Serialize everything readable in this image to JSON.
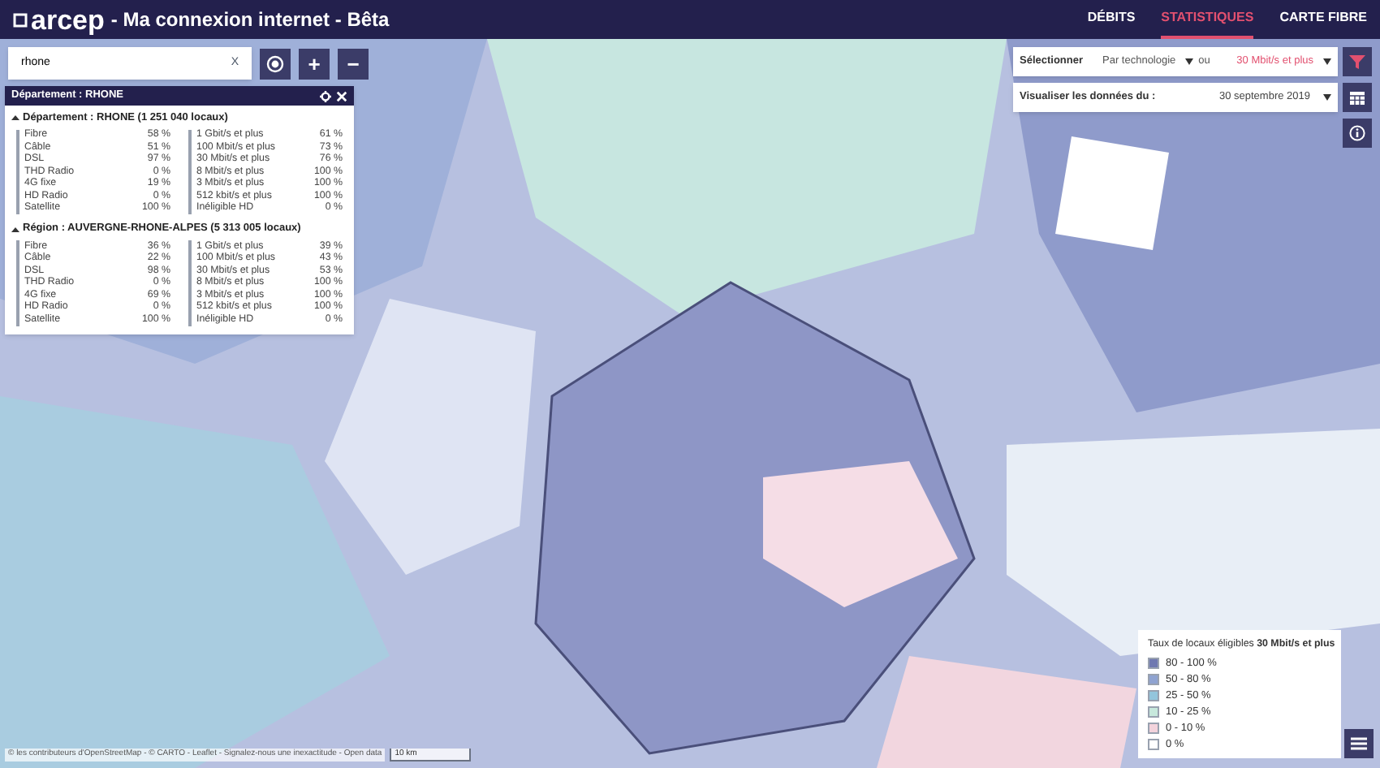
{
  "header": {
    "logo": "arcep",
    "title": "- Ma connexion internet - Bêta",
    "nav": [
      {
        "label": "DÉBITS",
        "selected": false
      },
      {
        "label": "STATISTIQUES",
        "selected": true
      },
      {
        "label": "CARTE FIBRE",
        "selected": false
      }
    ]
  },
  "search": {
    "value": "rhone",
    "clear": "X"
  },
  "zoom": {
    "in": "+",
    "out": "−"
  },
  "panel": {
    "title": "Département : RHONE",
    "sections": [
      {
        "heading": "Département : RHONE (1 251 040 locaux)",
        "expanded": true,
        "technologies": [
          {
            "name": "Fibre",
            "value": "58 %"
          },
          {
            "name": "Câble",
            "value": "51 %"
          },
          {
            "name": "DSL",
            "value": "97 %"
          },
          {
            "name": "THD Radio",
            "value": "0 %"
          },
          {
            "name": "4G fixe",
            "value": "19 %"
          },
          {
            "name": "HD Radio",
            "value": "0 %"
          },
          {
            "name": "Satellite",
            "value": "100 %"
          }
        ],
        "speeds": [
          {
            "name": "1 Gbit/s et plus",
            "value": "61 %"
          },
          {
            "name": "100 Mbit/s et plus",
            "value": "73 %"
          },
          {
            "name": "30 Mbit/s et plus",
            "value": "76 %"
          },
          {
            "name": "8 Mbit/s et plus",
            "value": "100 %"
          },
          {
            "name": "3 Mbit/s et plus",
            "value": "100 %"
          },
          {
            "name": "512 kbit/s et plus",
            "value": "100 %"
          },
          {
            "name": "Inéligible HD",
            "value": "0 %"
          }
        ]
      },
      {
        "heading": "Région : AUVERGNE-RHONE-ALPES (5 313 005 locaux)",
        "expanded": true,
        "technologies": [
          {
            "name": "Fibre",
            "value": "36 %"
          },
          {
            "name": "Câble",
            "value": "22 %"
          },
          {
            "name": "DSL",
            "value": "98 %"
          },
          {
            "name": "THD Radio",
            "value": "0 %"
          },
          {
            "name": "4G fixe",
            "value": "69 %"
          },
          {
            "name": "HD Radio",
            "value": "0 %"
          },
          {
            "name": "Satellite",
            "value": "100 %"
          }
        ],
        "speeds": [
          {
            "name": "1 Gbit/s et plus",
            "value": "39 %"
          },
          {
            "name": "100 Mbit/s et plus",
            "value": "43 %"
          },
          {
            "name": "30 Mbit/s et plus",
            "value": "53 %"
          },
          {
            "name": "8 Mbit/s et plus",
            "value": "100 %"
          },
          {
            "name": "3 Mbit/s et plus",
            "value": "100 %"
          },
          {
            "name": "512 kbit/s et plus",
            "value": "100 %"
          },
          {
            "name": "Inéligible HD",
            "value": "0 %"
          }
        ]
      }
    ]
  },
  "filters": {
    "select_label": "Sélectionner",
    "technology": "Par technologie",
    "or": "ou",
    "speed": "30 Mbit/s et plus",
    "date_label": "Visualiser les données du :",
    "date": "30 septembre 2019"
  },
  "legend": {
    "title": "Taux de locaux éligibles **30 Mbit/s et plus**",
    "items": [
      {
        "label": "80 - 100 %",
        "color": "#6f78b0"
      },
      {
        "label": "50 - 80 %",
        "color": "#8fa3d1"
      },
      {
        "label": "25 - 50 %",
        "color": "#93c5dc"
      },
      {
        "label": "10 - 25 %",
        "color": "#c7e8dc"
      },
      {
        "label": "0 - 10 %",
        "color": "#f3d3dc"
      },
      {
        "label": "0 %",
        "color": "#ffffff"
      }
    ]
  },
  "attribution": {
    "text": "© les contributeurs d'OpenStreetMap - © CARTO - Leaflet - Signalez-nous une inexactitude - Open data",
    "scale": "10 km"
  }
}
